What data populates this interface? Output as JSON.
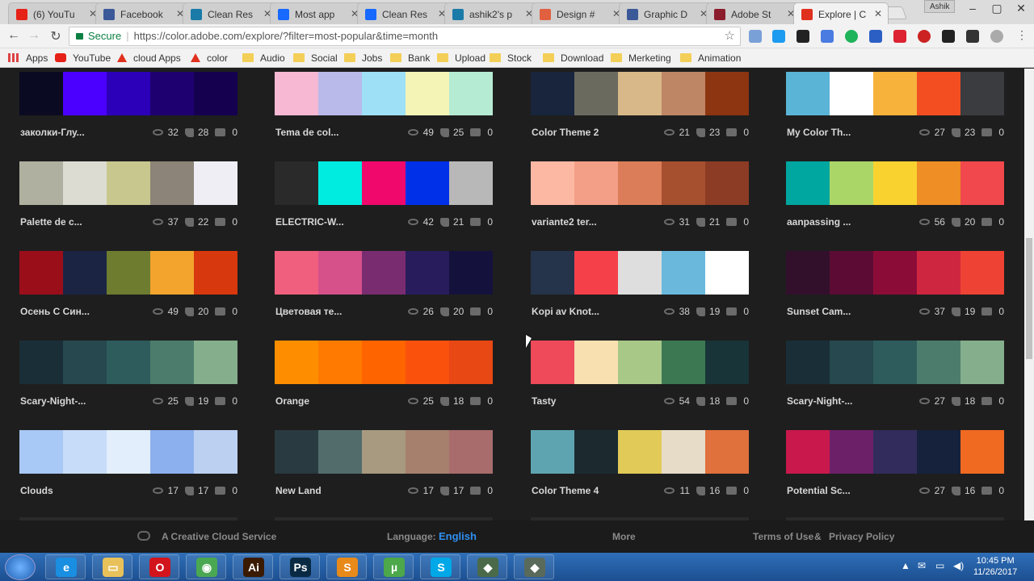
{
  "browser": {
    "tabs": [
      {
        "label": "(6) YouTu",
        "color": "#e62117"
      },
      {
        "label": "Facebook",
        "color": "#3b5998"
      },
      {
        "label": "Clean Res",
        "color": "#1a7ba8"
      },
      {
        "label": "Most app",
        "color": "#1769ff"
      },
      {
        "label": "Clean Res",
        "color": "#1769ff"
      },
      {
        "label": "ashik2's p",
        "color": "#1a7ba8"
      },
      {
        "label": "Design #",
        "color": "#e06040"
      },
      {
        "label": "Graphic D",
        "color": "#3b5998"
      },
      {
        "label": "Adobe St",
        "color": "#8b1d2c"
      },
      {
        "label": "Explore | C",
        "color": "#e0301e"
      }
    ],
    "user_badge": "Ashik",
    "secure_label": "Secure",
    "url": "https://color.adobe.com/explore/?filter=most-popular&time=month",
    "bookmarks": [
      {
        "label": "Apps",
        "icon": "apps-grid-icon"
      },
      {
        "label": "YouTube",
        "icon": "youtube-icon"
      },
      {
        "label": "cloud Apps",
        "icon": "adobe-icon"
      },
      {
        "label": "color",
        "icon": "adobe-icon"
      },
      {
        "label": "Audio",
        "icon": "folder-icon"
      },
      {
        "label": "Social",
        "icon": "folder-icon"
      },
      {
        "label": "Jobs",
        "icon": "folder-icon"
      },
      {
        "label": "Bank",
        "icon": "folder-icon"
      },
      {
        "label": "Upload",
        "icon": "folder-icon"
      },
      {
        "label": "Stock",
        "icon": "folder-icon"
      },
      {
        "label": "Download",
        "icon": "folder-icon"
      },
      {
        "label": "Merketing",
        "icon": "folder-icon"
      },
      {
        "label": "Animation",
        "icon": "folder-icon"
      }
    ]
  },
  "themes": [
    {
      "name": "заколки-Глу...",
      "views": "32",
      "likes": "28",
      "comments": "0",
      "colors": [
        "#0a0a22",
        "#4b00ff",
        "#2b00b8",
        "#1e0070",
        "#14004f"
      ]
    },
    {
      "name": "Tema de col...",
      "views": "49",
      "likes": "25",
      "comments": "0",
      "colors": [
        "#f6b8d2",
        "#b9b9ea",
        "#9ee0f6",
        "#f4f4b6",
        "#b6ebd3"
      ]
    },
    {
      "name": "Color Theme 2",
      "views": "21",
      "likes": "23",
      "comments": "0",
      "colors": [
        "#18253c",
        "#6a6b5e",
        "#d8b888",
        "#bf8666",
        "#8c3510"
      ]
    },
    {
      "name": "My Color Th...",
      "views": "27",
      "likes": "23",
      "comments": "0",
      "colors": [
        "#5ab4d6",
        "#ffffff",
        "#f7b23c",
        "#f24e22",
        "#3a3c3f"
      ]
    },
    {
      "name": "Palette de c...",
      "views": "37",
      "likes": "22",
      "comments": "0",
      "colors": [
        "#b0b0a0",
        "#dcdcd2",
        "#c8c88e",
        "#8c8478",
        "#eeeef4"
      ]
    },
    {
      "name": "ELECTRIC-W...",
      "views": "42",
      "likes": "21",
      "comments": "0",
      "colors": [
        "#2a2a2a",
        "#00ece0",
        "#f0086c",
        "#0030e8",
        "#b8b8b8"
      ]
    },
    {
      "name": "variante2 ter...",
      "views": "31",
      "likes": "21",
      "comments": "0",
      "colors": [
        "#fdb8a4",
        "#f39e86",
        "#db7d58",
        "#a65030",
        "#8c3c24"
      ]
    },
    {
      "name": "aanpassing ...",
      "views": "56",
      "likes": "20",
      "comments": "0",
      "colors": [
        "#00a6a0",
        "#aad668",
        "#f9d230",
        "#ee8e24",
        "#f0484c"
      ]
    },
    {
      "name": "Осень С Син...",
      "views": "49",
      "likes": "20",
      "comments": "0",
      "colors": [
        "#9a0e1a",
        "#1c2444",
        "#6e7c30",
        "#f2a42c",
        "#d8380e"
      ]
    },
    {
      "name": "Цветовая те...",
      "views": "26",
      "likes": "20",
      "comments": "0",
      "colors": [
        "#f0607e",
        "#d6508a",
        "#7a2c70",
        "#281c5c",
        "#14123c"
      ]
    },
    {
      "name": "Kopi av Knot...",
      "views": "38",
      "likes": "19",
      "comments": "0",
      "colors": [
        "#25344a",
        "#f5404a",
        "#dedede",
        "#6ab8dc",
        "#ffffff"
      ]
    },
    {
      "name": "Sunset Cam...",
      "views": "37",
      "likes": "19",
      "comments": "0",
      "colors": [
        "#32102c",
        "#5c0c34",
        "#8c0c38",
        "#ce2640",
        "#ee4234"
      ]
    },
    {
      "name": "Scary-Night-...",
      "views": "25",
      "likes": "19",
      "comments": "0",
      "colors": [
        "#1a2e38",
        "#26484e",
        "#2e5c5c",
        "#4c7c6c",
        "#84ae8c"
      ]
    },
    {
      "name": "Orange",
      "views": "25",
      "likes": "18",
      "comments": "0",
      "colors": [
        "#fe8e00",
        "#fe7a00",
        "#fe6400",
        "#fa520c",
        "#e84814"
      ]
    },
    {
      "name": "Tasty",
      "views": "54",
      "likes": "18",
      "comments": "0",
      "colors": [
        "#ee4a5a",
        "#f8e0b0",
        "#a8c888",
        "#3c7852",
        "#183438"
      ]
    },
    {
      "name": "Scary-Night-...",
      "views": "27",
      "likes": "18",
      "comments": "0",
      "colors": [
        "#1a2e38",
        "#26484e",
        "#2e5c5c",
        "#4c7c6c",
        "#84ae8c"
      ]
    },
    {
      "name": "Clouds",
      "views": "17",
      "likes": "17",
      "comments": "0",
      "colors": [
        "#a8c8f6",
        "#c6dcf8",
        "#e2eefc",
        "#8cb0ee",
        "#bcd0f2"
      ]
    },
    {
      "name": "New Land",
      "views": "17",
      "likes": "17",
      "comments": "0",
      "colors": [
        "#293a40",
        "#526c6c",
        "#a89a80",
        "#a6806c",
        "#a86c6c"
      ]
    },
    {
      "name": "Color Theme 4",
      "views": "11",
      "likes": "16",
      "comments": "0",
      "colors": [
        "#5ea4b0",
        "#1c2a30",
        "#e2ca58",
        "#e6dcc8",
        "#e0703c"
      ]
    },
    {
      "name": "Potential Sc...",
      "views": "27",
      "likes": "16",
      "comments": "0",
      "colors": [
        "#c8184c",
        "#6c2068",
        "#322c5c",
        "#16223c",
        "#f06a22"
      ]
    }
  ],
  "footer": {
    "service": "A Creative Cloud Service",
    "language_label": "Language:",
    "language_value": "English",
    "more": "More",
    "terms": "Terms of Use",
    "amp": "&",
    "privacy": "Privacy Policy"
  },
  "taskbar": {
    "time": "10:45 PM",
    "date": "11/26/2017",
    "apps": [
      {
        "name": "ie",
        "glyph": "e",
        "bg": "#1a8ee0"
      },
      {
        "name": "explorer",
        "glyph": "▭",
        "bg": "#e8c15a"
      },
      {
        "name": "opera",
        "glyph": "O",
        "bg": "#d2141c"
      },
      {
        "name": "chrome",
        "glyph": "◉",
        "bg": "#4aa852"
      },
      {
        "name": "illustrator",
        "glyph": "Ai",
        "bg": "#3a1a00"
      },
      {
        "name": "photoshop",
        "glyph": "Ps",
        "bg": "#0a2a44"
      },
      {
        "name": "sublime",
        "glyph": "S",
        "bg": "#e88a1a"
      },
      {
        "name": "utorrent",
        "glyph": "µ",
        "bg": "#4ca84a"
      },
      {
        "name": "skype",
        "glyph": "S",
        "bg": "#00a8e8"
      },
      {
        "name": "app1",
        "glyph": "◆",
        "bg": "#4a6a4a"
      },
      {
        "name": "app2",
        "glyph": "◆",
        "bg": "#5a6a5a"
      }
    ]
  }
}
